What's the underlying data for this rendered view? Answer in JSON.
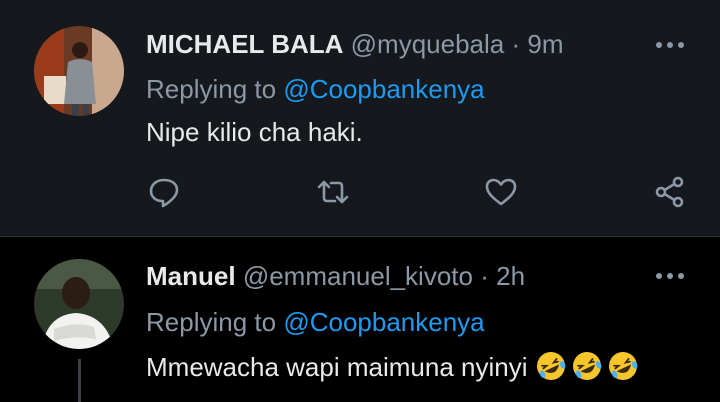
{
  "tweets": [
    {
      "display_name": "MICHAEL BALA",
      "handle": "@myquebala",
      "separator": "·",
      "time": "9m",
      "reply_prefix": "Replying to",
      "reply_mention": "@Coopbankenya",
      "text": "Nipe kilio cha haki.",
      "avatar": "avatar-person-standing",
      "actions": [
        "reply-icon",
        "retweet-icon",
        "like-icon",
        "share-icon"
      ]
    },
    {
      "display_name": "Manuel",
      "handle": "@emmanuel_kivoto",
      "separator": "·",
      "time": "2h",
      "reply_prefix": "Replying to",
      "reply_mention": "@Coopbankenya",
      "text": "Mmewacha wapi maimuna nyinyi",
      "emojis": [
        "🤣",
        "🤣",
        "🤣"
      ],
      "avatar": "avatar-person-portrait"
    }
  ],
  "colors": {
    "background": "#000000",
    "highlighted_tweet_bg": "#15181c",
    "primary_text": "#e7e9ea",
    "secondary_text": "#8b98a5",
    "link": "#1d9bf0",
    "divider": "#2f3336"
  }
}
